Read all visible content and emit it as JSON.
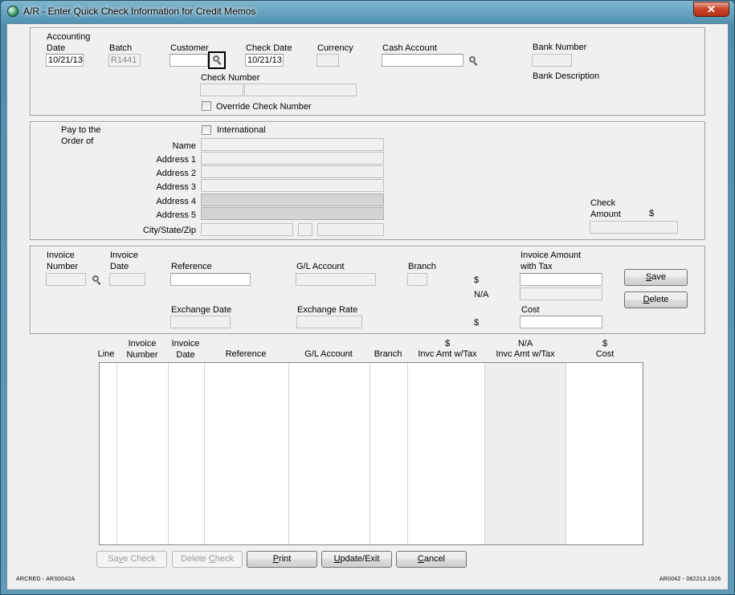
{
  "window": {
    "title": "A/R - Enter Quick Check Information for Credit Memos",
    "close_label": "✕"
  },
  "header": {
    "accounting_date_label1": "Accounting",
    "accounting_date_label2": "Date",
    "accounting_date_value": "10/21/13",
    "batch_label": "Batch",
    "batch_value": "R1441",
    "customer_label": "Customer",
    "customer_value": "",
    "check_date_label": "Check Date",
    "check_date_value": "10/21/13",
    "currency_label": "Currency",
    "currency_value": "",
    "cash_account_label": "Cash Account",
    "cash_account_value": "",
    "bank_number_label": "Bank Number",
    "bank_number_value": "",
    "bank_description_label": "Bank Description",
    "check_number_label": "Check Number",
    "check_number_value": "",
    "check_number_value2": "",
    "override_label": "Override Check Number"
  },
  "payee": {
    "pay_to_label1": "Pay to the",
    "pay_to_label2": "Order of",
    "international_label": "International",
    "name_label": "Name",
    "address1_label": "Address 1",
    "address2_label": "Address 2",
    "address3_label": "Address 3",
    "address4_label": "Address 4",
    "address5_label": "Address 5",
    "city_label": "City/State/Zip",
    "check_amount_label1": "Check",
    "check_amount_label2": "Amount",
    "check_amount_currency": "$"
  },
  "invoice": {
    "invoice_number_label1": "Invoice",
    "invoice_number_label2": "Number",
    "invoice_date_label1": "Invoice",
    "invoice_date_label2": "Date",
    "reference_label": "Reference",
    "gl_account_label": "G/L Account",
    "branch_label": "Branch",
    "amount_label1": "Invoice Amount",
    "amount_label2": "with Tax",
    "currency_symbol": "$",
    "na_label": "N/A",
    "exchange_date_label": "Exchange Date",
    "exchange_rate_label": "Exchange Rate",
    "cost_label": "Cost",
    "cost_currency": "$",
    "save_pre": "",
    "save_key": "S",
    "save_post": "ave",
    "delete_pre": "",
    "delete_key": "D",
    "delete_post": "elete"
  },
  "grid": {
    "columns": [
      {
        "line1": "",
        "line2": "Line"
      },
      {
        "line1": "Invoice",
        "line2": "Number"
      },
      {
        "line1": "Invoice",
        "line2": "Date"
      },
      {
        "line1": "",
        "line2": "Reference"
      },
      {
        "line1": "",
        "line2": "G/L Account"
      },
      {
        "line1": "",
        "line2": "Branch"
      },
      {
        "line1": "$",
        "line2": "Invc Amt w/Tax"
      },
      {
        "line1": "N/A",
        "line2": "Invc Amt w/Tax"
      },
      {
        "line1": "$",
        "line2": "Cost"
      }
    ]
  },
  "buttons": {
    "save_check_pre": "Sa",
    "save_check_key": "v",
    "save_check_post": "e Check",
    "delete_check_pre": "Delete ",
    "delete_check_key": "C",
    "delete_check_post": "heck",
    "print_pre": "",
    "print_key": "P",
    "print_post": "rint",
    "update_pre": "",
    "update_key": "U",
    "update_post": "pdate/Exit",
    "cancel_pre": "",
    "cancel_key": "C",
    "cancel_post": "ancel"
  },
  "footer": {
    "left": "ARCRED - ARS0042A",
    "right": "AR0042 - 082213.1926"
  }
}
